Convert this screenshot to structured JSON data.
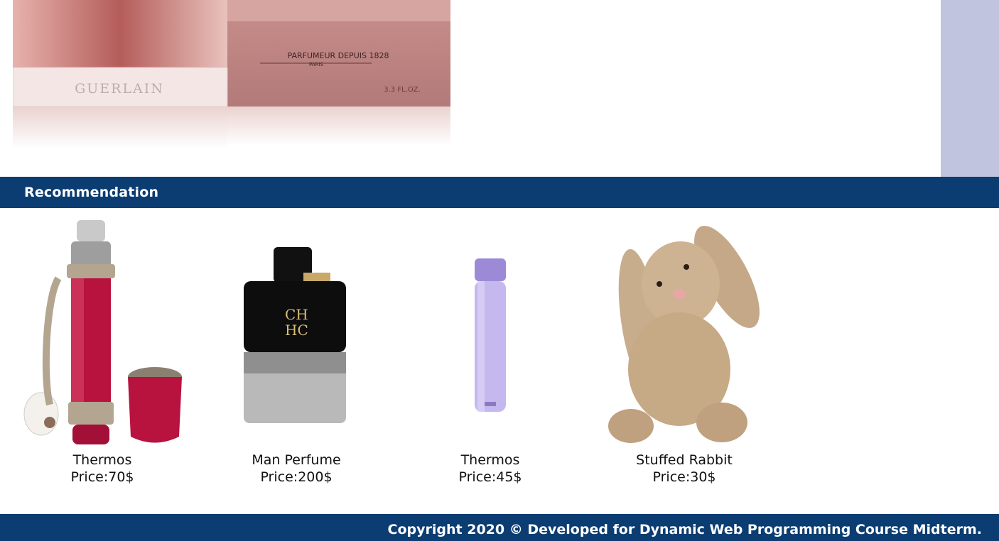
{
  "hero": {
    "image_icon": "perfume-box-image",
    "box_line1": "PARFUMEUR DEPUIS 1828",
    "box_line2": "PARIS",
    "box_size": "3.3 FL.OZ.",
    "bottle_brand": "GUERLAIN"
  },
  "recommendation": {
    "title": "Recommendation"
  },
  "products": [
    {
      "name": "Thermos",
      "price": "Price:70$",
      "icon": "red-thermos-image"
    },
    {
      "name": "Man Perfume",
      "price": "Price:200$",
      "icon": "ch-perfume-image"
    },
    {
      "name": "Thermos",
      "price": "Price:45$",
      "icon": "lilac-bottle-image"
    },
    {
      "name": "Stuffed Rabbit",
      "price": "Price:30$",
      "icon": "bunny-image"
    }
  ],
  "footer": {
    "text": "Copyright 2020 © Developed for Dynamic Web Programming Course Midterm."
  },
  "colors": {
    "bar": "#0b3d72",
    "side_panel": "#c0c4df"
  }
}
